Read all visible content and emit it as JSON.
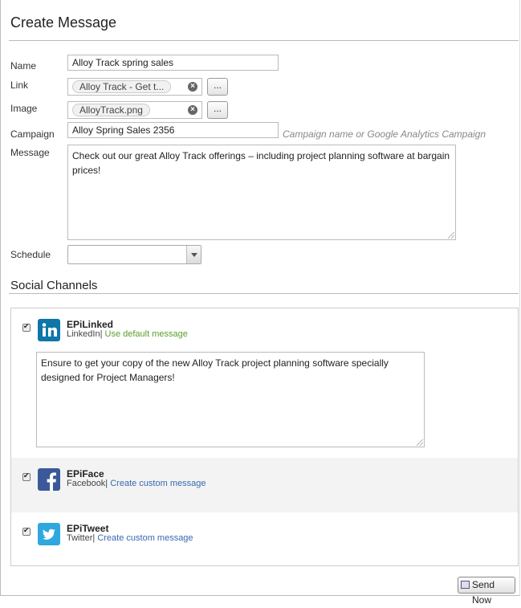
{
  "header": {
    "title": "Create Message"
  },
  "form": {
    "name_label": "Name",
    "name_value": "Alloy Track spring sales",
    "link_label": "Link",
    "link_value": "Alloy Track - Get t...",
    "image_label": "Image",
    "image_value": "AlloyTrack.png",
    "browse_label": "...",
    "campaign_label": "Campaign",
    "campaign_value": "Alloy Spring Sales 2356",
    "campaign_hint": "Campaign name or Google Analytics Campaign",
    "message_label": "Message",
    "message_value": "Check out our great Alloy Track offerings – including project planning software at bargain prices!",
    "schedule_label": "Schedule",
    "schedule_value": ""
  },
  "social": {
    "title": "Social Channels",
    "channels": [
      {
        "name": "EPiLinked",
        "network": "LinkedIn|",
        "action": "Use default message",
        "message": "Ensure to get your copy of the new Alloy Track project planning software specially designed for Project Managers!",
        "checked": true,
        "icon": "linkedin-icon",
        "color": "#0e76a8"
      },
      {
        "name": "EPiFace",
        "network": "Facebook|",
        "action": "Create custom message",
        "checked": true,
        "icon": "facebook-icon",
        "color": "#3b5998"
      },
      {
        "name": "EPiTweet",
        "network": "Twitter|",
        "action": "Create custom message",
        "checked": true,
        "icon": "twitter-icon",
        "color": "#2fa8e0"
      }
    ]
  },
  "footer": {
    "send_label": "Send Now"
  }
}
